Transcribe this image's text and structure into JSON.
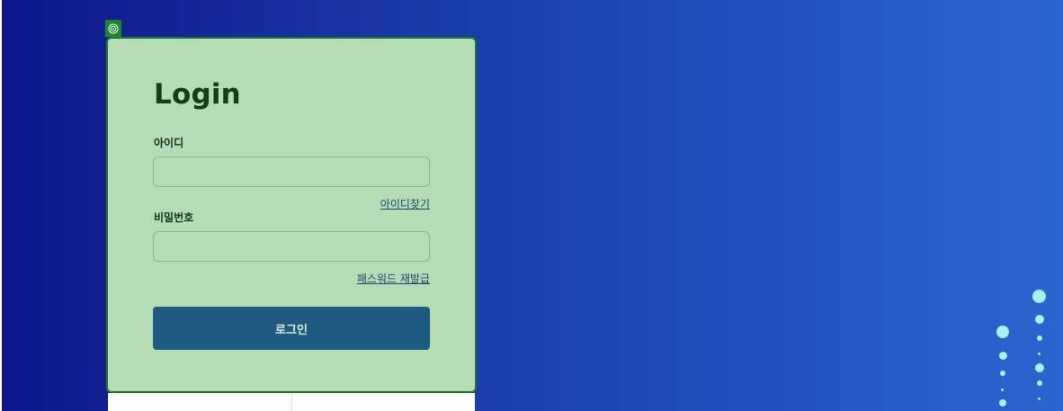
{
  "login": {
    "title": "Login",
    "id_label": "아이디",
    "id_value": "",
    "find_id_link": "아이디찾기",
    "password_label": "비밀번호",
    "password_value": "",
    "reset_password_link": "패스워드 재발급",
    "submit_label": "로그인"
  },
  "colors": {
    "background_start": "#0e168a",
    "background_end": "#2a66cf",
    "card_background": "#b4ddb6",
    "card_border": "#1a7a28",
    "title_text": "#173d17",
    "button_background": "#1e5a82",
    "button_text": "#d6f0d8",
    "link_text": "#1c4a6e",
    "decorative_dots": "#a9f0ff"
  },
  "icons": {
    "badge": "target-icon"
  }
}
